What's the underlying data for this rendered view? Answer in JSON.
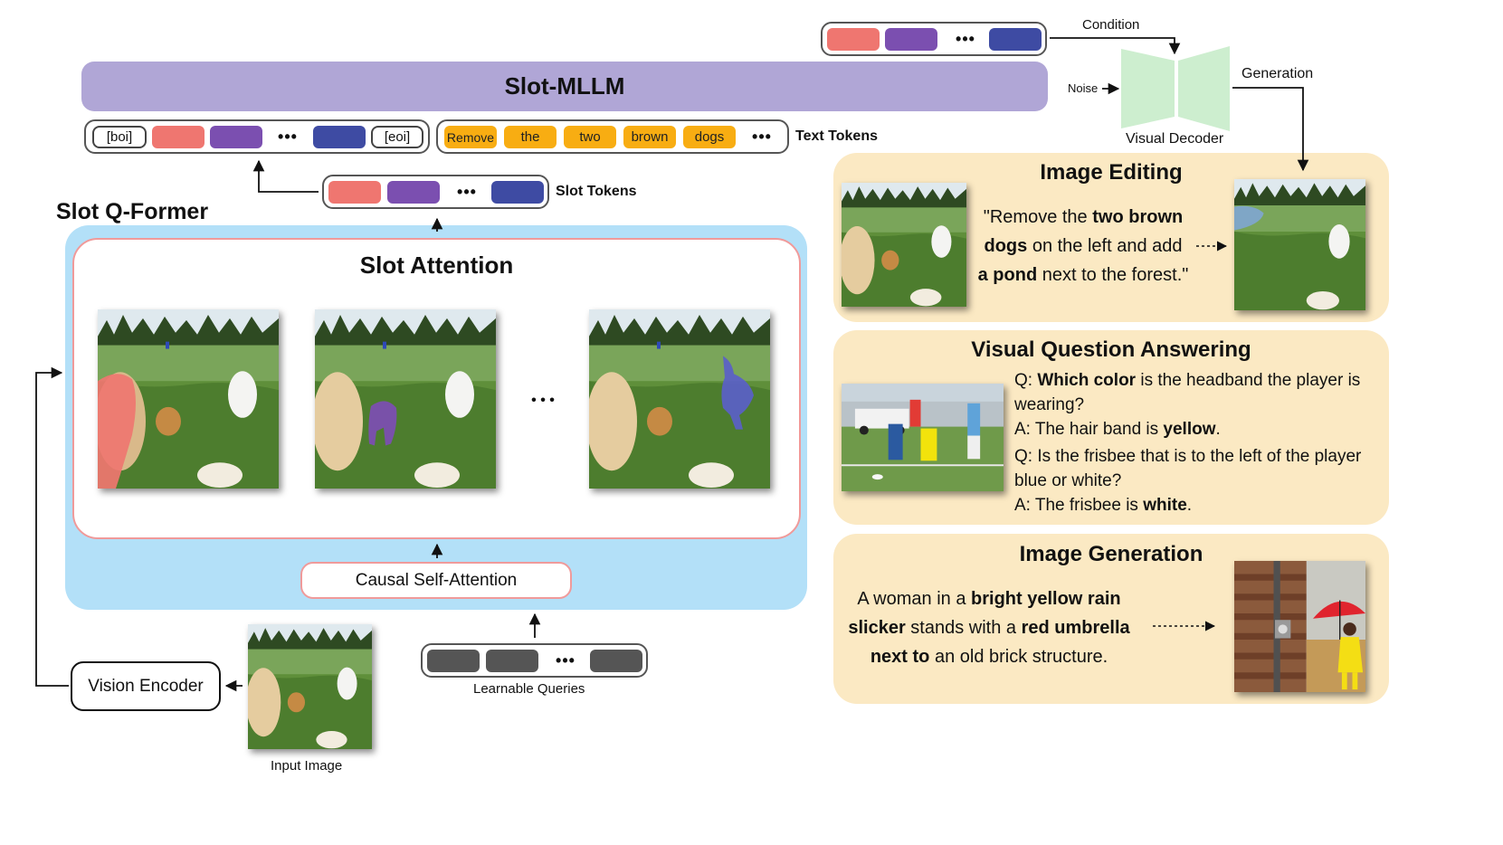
{
  "slot_mllm": {
    "title": "Slot-MLLM"
  },
  "top_tokens": {
    "dots": "•••"
  },
  "decoder": {
    "condition_label": "Condition",
    "noise_label": "Noise",
    "generation_label": "Generation",
    "decoder_label": "Visual Decoder"
  },
  "input_sequence": {
    "boi": "[boi]",
    "eoi": "[eoi]",
    "dots": "•••",
    "text_tokens": [
      "Remove",
      "the",
      "two",
      "brown",
      "dogs"
    ],
    "text_dots": "•••",
    "text_tokens_label": "Text Tokens"
  },
  "slot_tokens": {
    "dots": "•••",
    "label": "Slot Tokens"
  },
  "qformer": {
    "title": "Slot Q-Former",
    "slot_attention_title": "Slot Attention",
    "images_dots": "• • •",
    "causal_self_attention": "Causal Self-Attention"
  },
  "bottom": {
    "vision_encoder": "Vision Encoder",
    "input_image_label": "Input Image",
    "queries_dots": "•••",
    "learnable_queries_label": "Learnable Queries"
  },
  "editing": {
    "title": "Image Editing",
    "lines": [
      [
        {
          "t": "\"Remove the ",
          "b": false
        },
        {
          "t": "two brown",
          "b": true
        }
      ],
      [
        {
          "t": "dogs",
          "b": true
        },
        {
          "t": " on the left and add",
          "b": false
        }
      ],
      [
        {
          "t": "a pond",
          "b": true
        },
        {
          "t": " next to the forest.\"",
          "b": false
        }
      ]
    ]
  },
  "vqa": {
    "title": "Visual Question Answering",
    "lines": [
      [
        {
          "t": "Q: ",
          "b": false
        },
        {
          "t": "Which color",
          "b": true
        },
        {
          "t": " is the headband the player is",
          "b": false
        }
      ],
      [
        {
          "t": "wearing?",
          "b": false
        }
      ],
      [
        {
          "t": "A: The hair band is ",
          "b": false
        },
        {
          "t": "yellow",
          "b": true
        },
        {
          "t": ".",
          "b": false
        }
      ],
      [
        {
          "t": "Q: Is the frisbee that is to the left of the player",
          "b": false
        }
      ],
      [
        {
          "t": "blue or white?",
          "b": false
        }
      ],
      [
        {
          "t": "A: The frisbee is ",
          "b": false
        },
        {
          "t": "white",
          "b": true
        },
        {
          "t": ".",
          "b": false
        }
      ]
    ]
  },
  "generation": {
    "title": "Image Generation",
    "lines": [
      [
        {
          "t": "A woman in a ",
          "b": false
        },
        {
          "t": "bright yellow rain",
          "b": true
        }
      ],
      [
        {
          "t": "slicker",
          "b": true
        },
        {
          "t": " stands with a ",
          "b": false
        },
        {
          "t": "red umbrella",
          "b": true
        }
      ],
      [
        {
          "t": "next to",
          "b": true
        },
        {
          "t": " an old brick structure.",
          "b": false
        }
      ]
    ]
  },
  "colors": {
    "mllm_bar": "#b0a6d6",
    "qformer_bg": "#b3e0f8",
    "panel_bg": "#fbe9c3",
    "token_red": "#ef7670",
    "token_purple": "#7b4fb0",
    "token_blue": "#3e4ba3",
    "token_orange": "#f8ad12",
    "decoder_green": "#cdeecf"
  }
}
